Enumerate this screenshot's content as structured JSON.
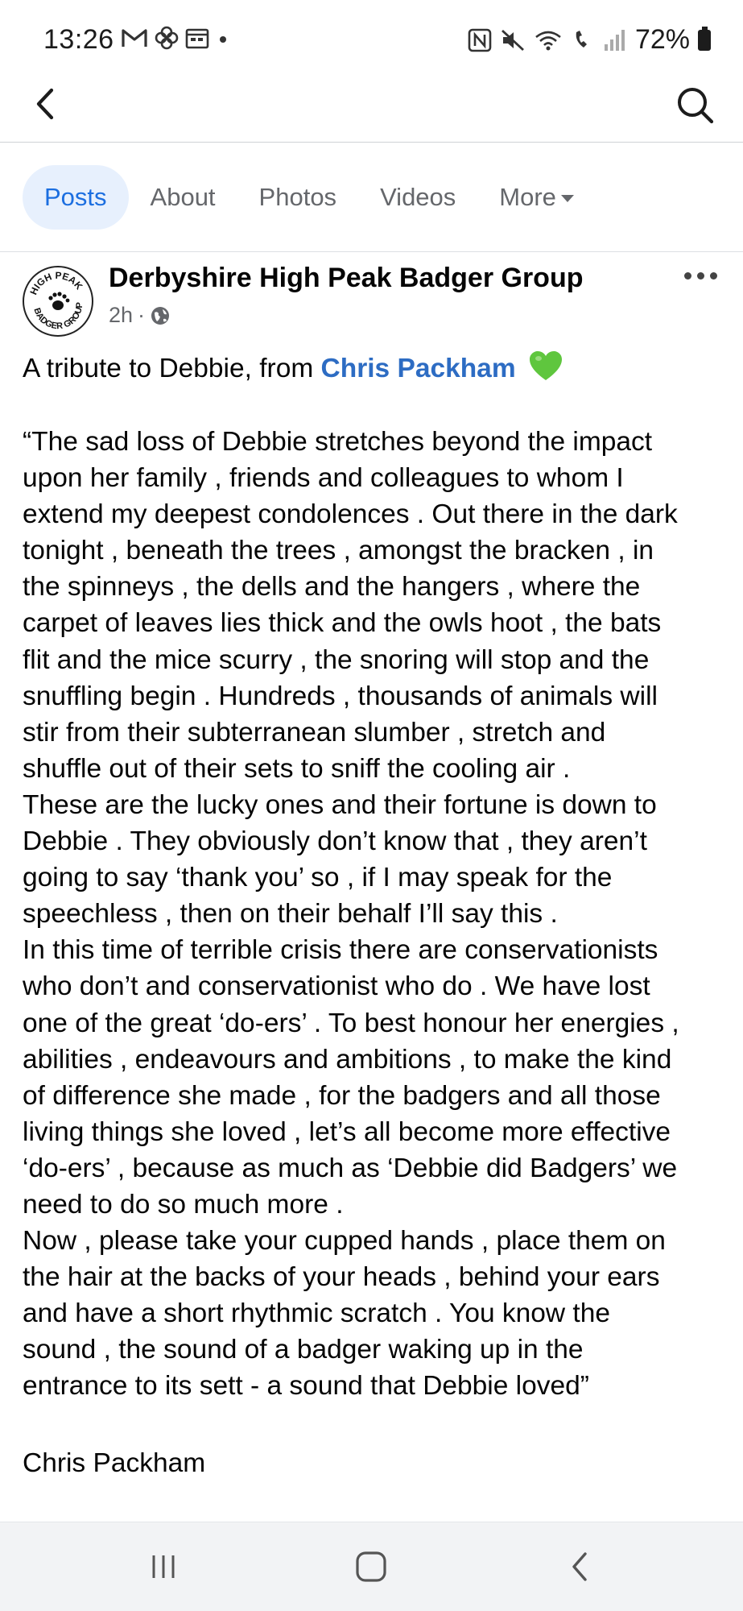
{
  "status_bar": {
    "time": "13:26",
    "battery": "72%"
  },
  "tabs": [
    {
      "label": "Posts",
      "active": true
    },
    {
      "label": "About",
      "active": false
    },
    {
      "label": "Photos",
      "active": false
    },
    {
      "label": "Videos",
      "active": false
    },
    {
      "label": "More",
      "active": false
    }
  ],
  "post": {
    "page_name": "Derbyshire High Peak Badger Group",
    "time": "2h",
    "meta_separator": "·",
    "avatar_text": "HIGH PEAK BADGER GROUP",
    "intro_text": "A tribute to Debbie, from ",
    "mention": "Chris Packham",
    "body_lines": [
      "“The sad loss of Debbie stretches beyond the impact",
      "upon her family , friends and colleagues to whom I",
      "extend my deepest condolences . Out there in the dark",
      "tonight , beneath the trees , amongst the bracken , in",
      "the spinneys , the dells and the hangers , where the",
      "carpet of leaves lies thick and the owls hoot , the bats",
      "flit and the mice scurry , the snoring will stop and the",
      "snuffling begin . Hundreds , thousands of animals will",
      "stir from their subterranean slumber , stretch and",
      "shuffle out of their sets to sniff the cooling air .",
      "These are the lucky ones and their fortune is down to",
      "Debbie . They obviously don’t know that , they aren’t",
      "going to say ‘thank you’ so , if I may speak for the",
      "speechless , then on their behalf I’ll say this .",
      "In this time of terrible crisis there are conservationists",
      "who don’t and conservationist who do . We have lost",
      "one of the great ‘do-ers’ . To best honour her energies ,",
      "abilities , endeavours and ambitions , to make the kind",
      "of difference she made , for the badgers and all those",
      "living things she loved , let’s all become more effective",
      "‘do-ers’ , because as much as ‘Debbie did Badgers’ we",
      "need to do so much more .",
      "Now , please take your cupped hands , place them on",
      "the hair at the backs of your heads , behind your ears",
      "and have a short rhythmic scratch . You know the",
      "sound , the sound of a badger waking up in the",
      "entrance to its sett - a sound that Debbie loved”"
    ],
    "signature": "Chris Packham"
  },
  "colors": {
    "accent": "#1b6ee0",
    "tab_active_bg": "#e7f0fd",
    "mention": "#2d6cc3",
    "secondary_text": "#65676b",
    "heart": "#5fc63e"
  }
}
